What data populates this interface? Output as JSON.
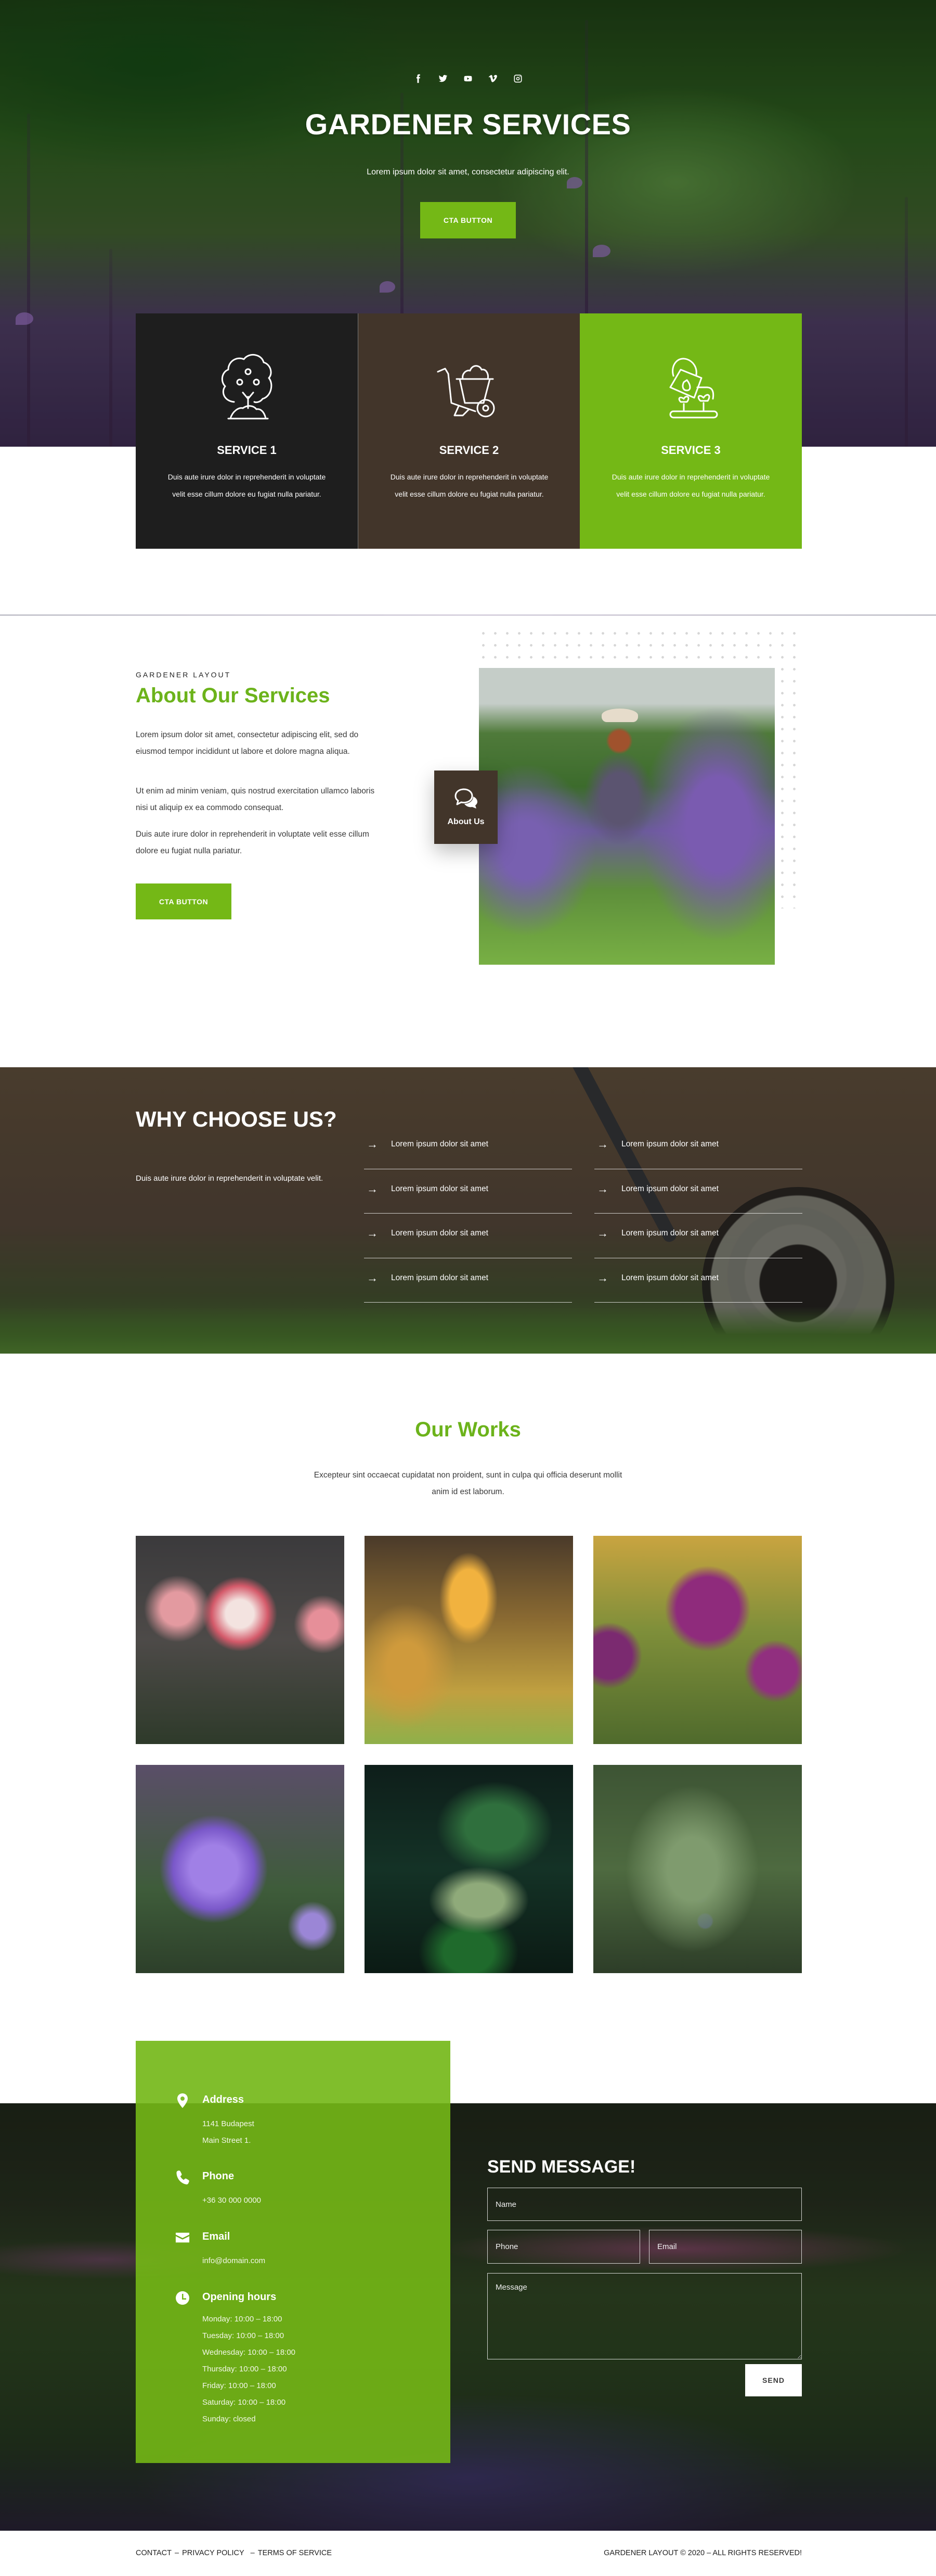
{
  "colors": {
    "accent_green": "#74b816",
    "heading_green": "#6cb31b",
    "dark_card": "#1e1e1e",
    "brown_card": "#42352a"
  },
  "hero": {
    "social_icons": [
      {
        "name": "facebook-icon",
        "label": "Facebook"
      },
      {
        "name": "twitter-icon",
        "label": "Twitter"
      },
      {
        "name": "youtube-icon",
        "label": "YouTube"
      },
      {
        "name": "vimeo-icon",
        "label": "Vimeo"
      },
      {
        "name": "instagram-icon",
        "label": "Instagram"
      }
    ],
    "title": "GARDENER SERVICES",
    "subtitle": "Lorem ipsum dolor sit amet, consectetur adipiscing elit.",
    "cta_label": "CTA BUTTON"
  },
  "services": [
    {
      "icon": "tree-icon",
      "title": "SERVICE 1",
      "text": "Duis aute irure dolor in reprehenderit in voluptate velit esse cillum dolore eu fugiat nulla pariatur."
    },
    {
      "icon": "wheelbarrow-icon",
      "title": "SERVICE 2",
      "text": "Duis aute irure dolor in reprehenderit in voluptate velit esse cillum dolore eu fugiat nulla pariatur."
    },
    {
      "icon": "watering-can-icon",
      "title": "SERVICE 3",
      "text": "Duis aute irure dolor in reprehenderit in voluptate velit esse cillum dolore eu fugiat nulla pariatur."
    }
  ],
  "about": {
    "label": "GARDENER LAYOUT",
    "title": "About Our Services",
    "paragraphs": [
      "Lorem ipsum dolor sit amet, consectetur adipiscing elit, sed do eiusmod tempor incididunt ut labore et dolore magna aliqua.",
      "Ut enim ad minim veniam, quis nostrud exercitation ullamco laboris nisi ut aliquip ex ea commodo consequat.",
      "Duis aute irure dolor in reprehenderit in voluptate velit esse cillum dolore eu fugiat nulla pariatur."
    ],
    "cta_label": "CTA BUTTON",
    "badge_label": "About Us",
    "badge_icon": "chat-bubbles-icon"
  },
  "why": {
    "title": "WHY CHOOSE US?",
    "text": "Duis aute irure dolor in reprehenderit in voluptate velit.",
    "items": [
      "Lorem ipsum dolor sit amet",
      "Lorem ipsum dolor sit amet",
      "Lorem ipsum dolor sit amet",
      "Lorem ipsum dolor sit amet",
      "Lorem ipsum dolor sit amet",
      "Lorem ipsum dolor sit amet",
      "Lorem ipsum dolor sit amet",
      "Lorem ipsum dolor sit amet"
    ],
    "arrow": "→"
  },
  "works": {
    "title": "Our Works",
    "description": "Excepteur sint occaecat cupidatat non proident, sunt in culpa qui officia deserunt mollit anim id est laborum.",
    "images": [
      {
        "subject": "pink-white roses"
      },
      {
        "subject": "yellow tulip"
      },
      {
        "subject": "purple allium"
      },
      {
        "subject": "violet aster"
      },
      {
        "subject": "green leaves with buds"
      },
      {
        "subject": "juniper with berries"
      }
    ]
  },
  "contact": {
    "address": {
      "title": "Address",
      "lines": [
        "1141 Budapest",
        "Main Street 1."
      ]
    },
    "phone": {
      "title": "Phone",
      "lines": [
        "+36 30 000 0000"
      ]
    },
    "email": {
      "title": "Email",
      "lines": [
        "info@domain.com"
      ]
    },
    "hours": {
      "title": "Opening hours",
      "lines": [
        "Monday: 10:00 – 18:00",
        "Tuesday: 10:00 – 18:00",
        "Wednesday: 10:00 – 18:00",
        "Thursday: 10:00 – 18:00",
        "Friday: 10:00 – 18:00",
        "Saturday: 10:00 – 18:00",
        "Sunday: closed"
      ]
    },
    "form": {
      "title": "SEND MESSAGE!",
      "name_placeholder": "Name",
      "phone_placeholder": "Phone",
      "email_placeholder": "Email",
      "message_placeholder": "Message",
      "name_value": "",
      "phone_value": "",
      "email_value": "",
      "message_value": "",
      "send_label": "SEND"
    }
  },
  "footer": {
    "links": [
      "CONTACT",
      "PRIVACY POLICY",
      "TERMS OF SERVICE"
    ],
    "separator": "–",
    "copyright": "GARDENER LAYOUT © 2020 – ALL RIGHTS RESERVED!"
  }
}
